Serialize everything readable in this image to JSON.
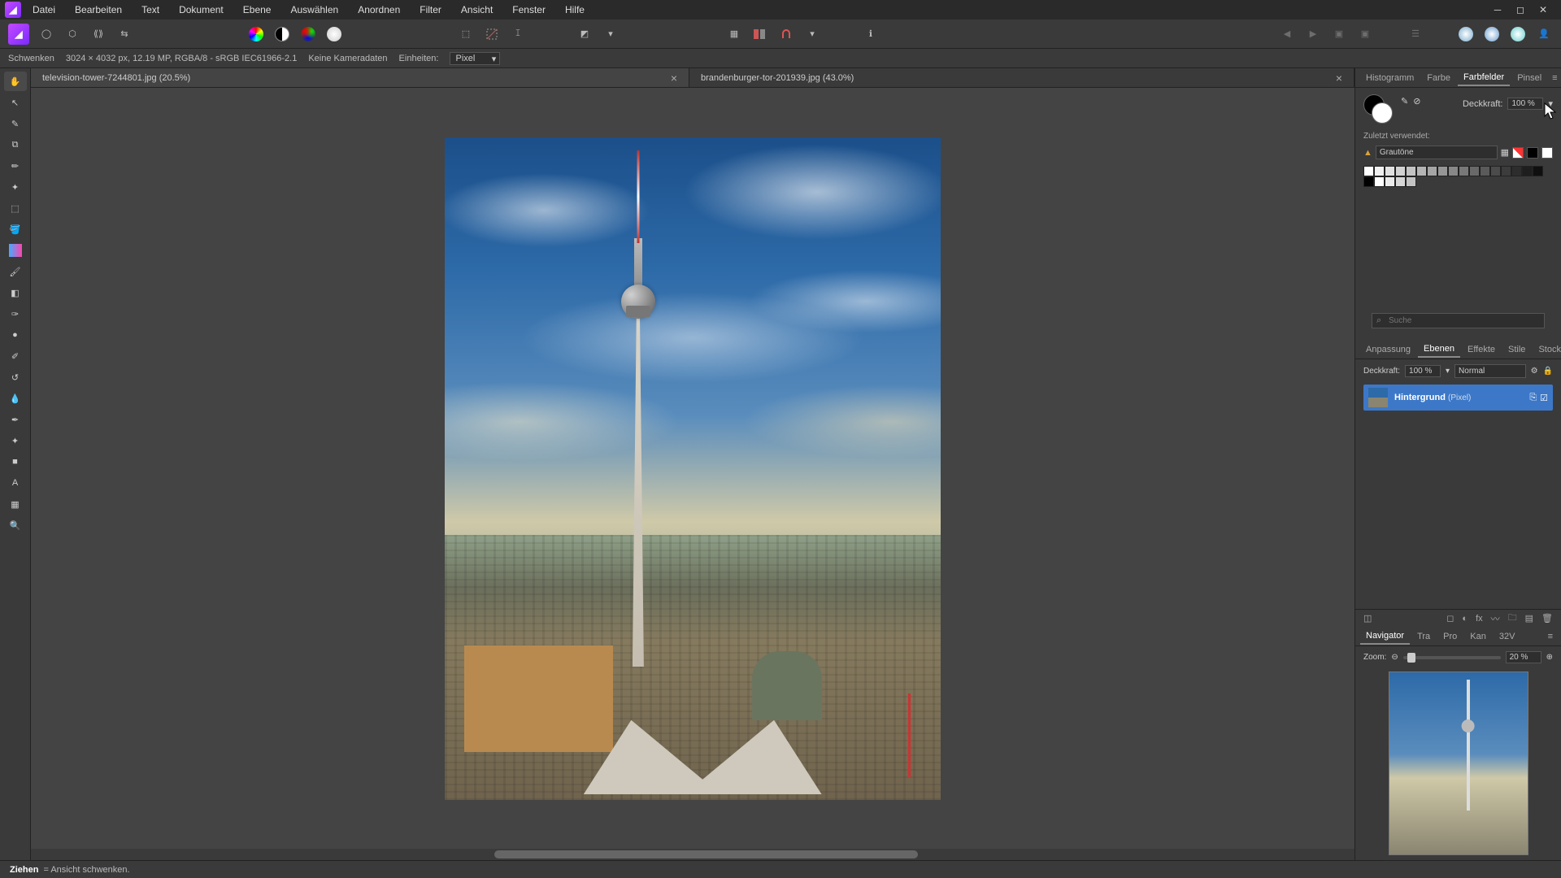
{
  "menu": {
    "items": [
      "Datei",
      "Bearbeiten",
      "Text",
      "Dokument",
      "Ebene",
      "Auswählen",
      "Anordnen",
      "Filter",
      "Ansicht",
      "Fenster",
      "Hilfe"
    ]
  },
  "infobar": {
    "tool": "Schwenken",
    "dims": "3024 × 4032 px, 12.19 MP, RGBA/8 - sRGB IEC61966-2.1",
    "camera": "Keine Kameradaten",
    "units_label": "Einheiten:",
    "units_value": "Pixel"
  },
  "tabs": [
    {
      "name": "television-tower-7244801.jpg (20.5%)",
      "active": true
    },
    {
      "name": "brandenburger-tor-201939.jpg (43.0%)",
      "active": false
    }
  ],
  "right": {
    "top_tabs": [
      "Histogramm",
      "Farbe",
      "Farbfelder",
      "Pinsel"
    ],
    "top_active": 2,
    "opacity_label": "Deckkraft:",
    "opacity_value": "100 %",
    "recent_label": "Zuletzt verwendet:",
    "palette_name": "Grautöne",
    "search_placeholder": "Suche",
    "mid_tabs": [
      "Anpassung",
      "Ebenen",
      "Effekte",
      "Stile",
      "Stock"
    ],
    "mid_active": 1,
    "layer_opacity_label": "Deckkraft:",
    "layer_opacity_value": "100 %",
    "blend_mode": "Normal",
    "layer_name": "Hintergrund",
    "layer_type": "(Pixel)",
    "nav_tabs": [
      "Navigator",
      "Tra",
      "Pro",
      "Kan",
      "32V"
    ],
    "nav_active": 0,
    "zoom_label": "Zoom:",
    "zoom_value": "20 %"
  },
  "status": {
    "keyword": "Ziehen",
    "rest": " = Ansicht schwenken."
  }
}
